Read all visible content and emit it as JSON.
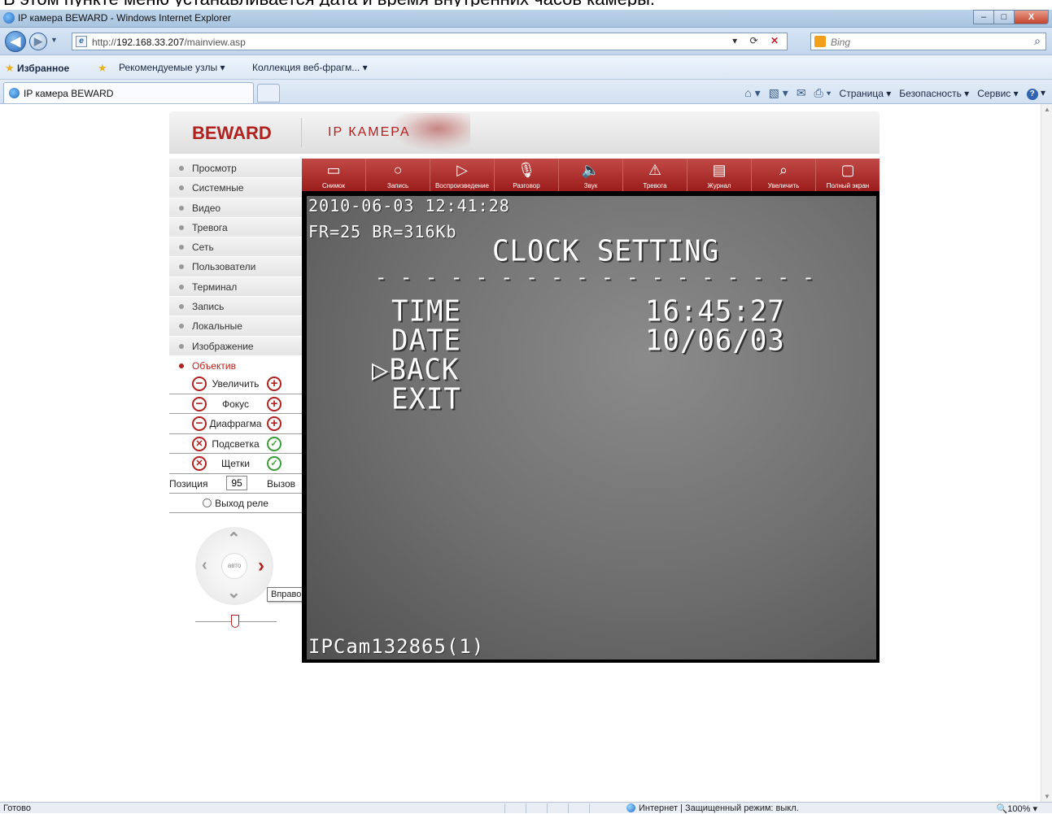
{
  "caption": "В этом пункте меню устанавливается дата и время внутренних часов камеры.",
  "window": {
    "title": "IP камера BEWARD - Windows Internet Explorer",
    "min": "–",
    "max": "□",
    "close": "X"
  },
  "address": {
    "url_prefix": "http://",
    "url_host": "192.168.33.207",
    "url_path": "/mainview.asp",
    "search_placeholder": "Bing"
  },
  "favorites": {
    "favorites": "Избранное",
    "suggested": "Рекомендуемые узлы ▾",
    "gallery": "Коллекция веб-фрагм... ▾"
  },
  "tab": {
    "title": "IP камера BEWARD"
  },
  "commands": {
    "page": "Страница ▾",
    "safety": "Безопасность ▾",
    "tools": "Сервис ▾",
    "help": "?"
  },
  "banner": {
    "logo": "BEWARD",
    "subtitle": "IP КАМЕРА"
  },
  "menu": [
    "Просмотр",
    "Системные",
    "Видео",
    "Тревога",
    "Сеть",
    "Пользователи",
    "Терминал",
    "Запись",
    "Локальные",
    "Изображение",
    "Объектив"
  ],
  "lens": {
    "zoom": "Увеличить",
    "focus": "Фокус",
    "iris": "Диафрагма",
    "backlight": "Подсветка",
    "wiper": "Щетки",
    "position_label": "Позиция",
    "position_value": "95",
    "call": "Вызов",
    "relay": "Выход реле"
  },
  "ptz": {
    "auto": "авто",
    "tooltip": "Вправо"
  },
  "toolbar": [
    {
      "label": "Снимок",
      "icon": "film-icon",
      "glyph": "▭"
    },
    {
      "label": "Запись",
      "icon": "record-icon",
      "glyph": "○"
    },
    {
      "label": "Воспроизведение",
      "icon": "play-icon",
      "glyph": "▷"
    },
    {
      "label": "Разговор",
      "icon": "microphone-icon",
      "glyph": "🎙"
    },
    {
      "label": "Звук",
      "icon": "speaker-icon",
      "glyph": "🔈"
    },
    {
      "label": "Тревога",
      "icon": "alarm-icon",
      "glyph": "⚠"
    },
    {
      "label": "Журнал",
      "icon": "clipboard-icon",
      "glyph": "▤"
    },
    {
      "label": "Увеличить",
      "icon": "magnifier-icon",
      "glyph": "⌕"
    },
    {
      "label": "Полный экран",
      "icon": "monitor-icon",
      "glyph": "▢"
    }
  ],
  "osd": {
    "datetime": "2010-06-03 12:41:28",
    "stats": "FR=25 BR=316Kb",
    "heading": "CLOCK SETTING",
    "divider": "- - - - - - - - - - - - - - - - - -",
    "time_label": "TIME",
    "time_value": "16:45:27",
    "date_label": "DATE",
    "date_value": "10/06/03",
    "back": "▷BACK",
    "exit": "EXIT",
    "camera_id": "IPCam132865(1)"
  },
  "status": {
    "left": "Готово",
    "zone": "Интернет | Защищенный режим: выкл.",
    "zoom": "🔍100% ▾"
  }
}
